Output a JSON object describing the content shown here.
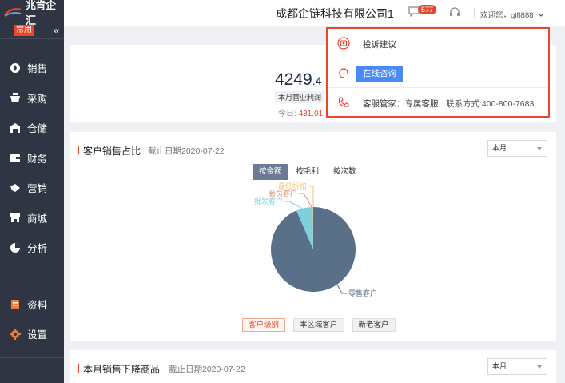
{
  "sidebar": {
    "logo_text": "兆肯企汇",
    "badge": "常用",
    "collapse_glyph": "«",
    "items": [
      {
        "label": "销售",
        "icon": "sales-icon"
      },
      {
        "label": "采购",
        "icon": "purchase-icon"
      },
      {
        "label": "仓储",
        "icon": "warehouse-icon"
      },
      {
        "label": "财务",
        "icon": "finance-icon"
      },
      {
        "label": "营销",
        "icon": "marketing-icon"
      },
      {
        "label": "商城",
        "icon": "mall-icon"
      },
      {
        "label": "分析",
        "icon": "analysis-icon"
      }
    ],
    "bottom_items": [
      {
        "label": "资料",
        "icon": "data-icon"
      },
      {
        "label": "设置",
        "icon": "gear-icon"
      }
    ]
  },
  "header": {
    "company": "成都企链科技有限公司1",
    "message_count": "577",
    "welcome": "欢迎您，ql8888"
  },
  "summary": {
    "value_main": "4249",
    "value_decimal": ".4",
    "label": "本月营业利润",
    "today_label": "今日: ",
    "today_value": "431.01"
  },
  "sales_card": {
    "title": "客户销售占比",
    "date": "截止日期2020-07-22",
    "period": "本月",
    "tabs": [
      "按金额",
      "按毛利",
      "按次数"
    ],
    "filters": [
      "客户级别",
      "本区域客户",
      "新老客户"
    ]
  },
  "decline_card": {
    "title": "本月销售下降商品",
    "date": "截止日期2020-07-22",
    "period": "本月"
  },
  "popover": {
    "complaint": "投诉建议",
    "online": "在线咨询",
    "butler": "客服管家：专属客服",
    "contact": "联系方式:400-800-7683"
  },
  "colors": {
    "accent": "#e8472b",
    "sidebar": "#2f3543",
    "pie_main": "#5a7089",
    "pie_minor": "#7dd0dc"
  },
  "chart_data": {
    "type": "pie",
    "labels": [
      "零售客户",
      "批发客户",
      "会员客户",
      "最低折扣"
    ],
    "values": [
      93.5,
      6.3,
      0.1,
      0.1
    ],
    "colors": [
      "#5a7089",
      "#7dd0dc",
      "#e88a6e",
      "#f2c46b"
    ]
  }
}
